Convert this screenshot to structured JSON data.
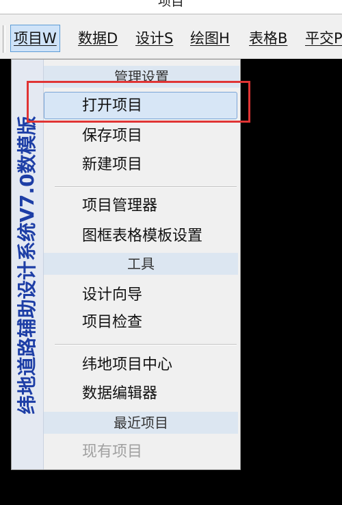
{
  "window": {
    "title": "项目"
  },
  "menubar": {
    "items": [
      {
        "label": "项目W",
        "active": true
      },
      {
        "label": "数据D"
      },
      {
        "label": "设计S"
      },
      {
        "label": "绘图H"
      },
      {
        "label": "表格B"
      },
      {
        "label": "平交P"
      }
    ]
  },
  "dropdown": {
    "side_banner": "纬地道路辅助设计系统V7.0数模版",
    "sections": {
      "management": "管理设置",
      "tools": "工具",
      "recent": "最近项目"
    },
    "items": {
      "open_project": "打开项目",
      "save_project": "保存项目",
      "new_project": "新建项目",
      "project_manager": "项目管理器",
      "frame_table_template": "图框表格模板设置",
      "design_wizard": "设计向导",
      "project_check": "项目检查",
      "weidi_center": "纬地项目中心",
      "data_editor": "数据编辑器",
      "existing_projects": "现有项目"
    }
  },
  "colors": {
    "highlight_annotation": "#e03434",
    "banner_text": "#1d3ea6",
    "menu_active": "#cfe3f8"
  }
}
